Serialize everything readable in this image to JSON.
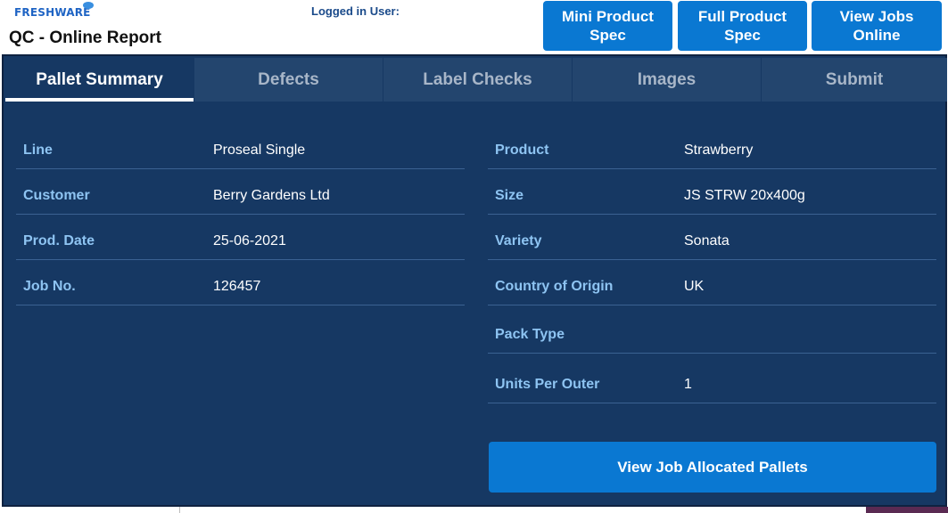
{
  "header": {
    "logo": {
      "part1": "FRESH",
      "part2": "WARE"
    },
    "title": "QC - Online Report",
    "logged_in_label": "Logged in User:",
    "buttons": [
      {
        "label": "Mini Product Spec"
      },
      {
        "label": "Full Product Spec"
      },
      {
        "label": "View Jobs Online"
      }
    ]
  },
  "tabs": [
    {
      "label": "Pallet Summary",
      "active": true
    },
    {
      "label": "Defects",
      "active": false
    },
    {
      "label": "Label Checks",
      "active": false
    },
    {
      "label": "Images",
      "active": false
    },
    {
      "label": "Submit",
      "active": false
    }
  ],
  "summary": {
    "left": [
      {
        "label": "Line",
        "value": "Proseal Single"
      },
      {
        "label": "Customer",
        "value": "Berry Gardens Ltd"
      },
      {
        "label": "Prod. Date",
        "value": "25-06-2021"
      },
      {
        "label": "Job No.",
        "value": "126457"
      }
    ],
    "right": [
      {
        "label": "Product",
        "value": "Strawberry"
      },
      {
        "label": "Size",
        "value": "JS STRW 20x400g"
      },
      {
        "label": "Variety",
        "value": "Sonata"
      },
      {
        "label": "Country of Origin",
        "value": "UK"
      },
      {
        "label": "Pack Type",
        "value": ""
      },
      {
        "label": "Units Per Outer",
        "value": "1"
      }
    ]
  },
  "actions": {
    "view_allocated_label": "View Job Allocated Pallets"
  },
  "colors": {
    "accent": "#0a78d2",
    "panel": "#163863",
    "label": "#8ec4f2"
  }
}
